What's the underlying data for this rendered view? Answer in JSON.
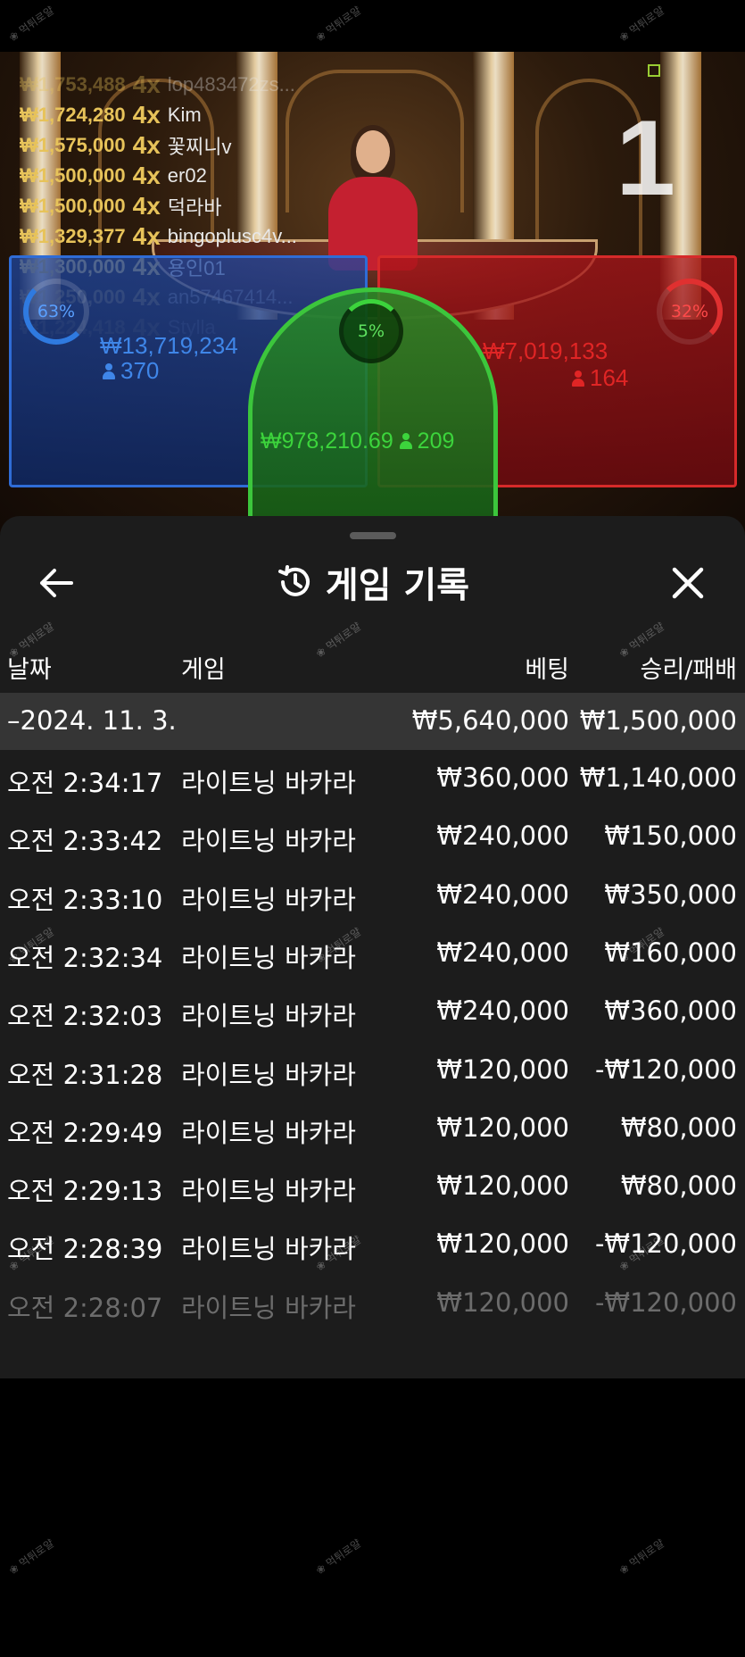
{
  "video": {
    "round_number": "1",
    "leaderboard": [
      {
        "amount": "₩1,753,488",
        "mult": "4x",
        "name": "lop483472zs..."
      },
      {
        "amount": "₩1,724,280",
        "mult": "4x",
        "name": "Kim"
      },
      {
        "amount": "₩1,575,000",
        "mult": "4x",
        "name": "꽃찌니v"
      },
      {
        "amount": "₩1,500,000",
        "mult": "4x",
        "name": "er02"
      },
      {
        "amount": "₩1,500,000",
        "mult": "4x",
        "name": "덕라바"
      },
      {
        "amount": "₩1,329,377",
        "mult": "4x",
        "name": "bingoplusc4v..."
      },
      {
        "amount": "₩1,300,000",
        "mult": "4x",
        "name": "용인01"
      },
      {
        "amount": "₩1,250,000",
        "mult": "4x",
        "name": "an57467414..."
      },
      {
        "amount": "₩1,224,418",
        "mult": "4x",
        "name": "Stylla"
      }
    ],
    "player": {
      "percent": "63%",
      "amount": "₩13,719,234",
      "count": "370",
      "color": "#2f7ae0"
    },
    "banker": {
      "percent": "32%",
      "amount": "₩7,019,133",
      "count": "164",
      "color": "#e03030"
    },
    "tie": {
      "percent": "5%",
      "amount": "₩978,210.69",
      "count": "209",
      "color": "#3cc63c"
    }
  },
  "history": {
    "title": "게임 기록",
    "columns": {
      "date": "날짜",
      "game": "게임",
      "bet": "베팅",
      "result": "승리/패배"
    },
    "group": {
      "date": "–2024. 11. 3.",
      "bet": "₩5,640,000",
      "result": "₩1,500,000"
    },
    "rows": [
      {
        "time": "오전 2:34:17",
        "game": "라이트닝 바카라",
        "bet": "₩360,000",
        "result": "₩1,140,000"
      },
      {
        "time": "오전 2:33:42",
        "game": "라이트닝 바카라",
        "bet": "₩240,000",
        "result": "₩150,000"
      },
      {
        "time": "오전 2:33:10",
        "game": "라이트닝 바카라",
        "bet": "₩240,000",
        "result": "₩350,000"
      },
      {
        "time": "오전 2:32:34",
        "game": "라이트닝 바카라",
        "bet": "₩240,000",
        "result": "₩160,000"
      },
      {
        "time": "오전 2:32:03",
        "game": "라이트닝 바카라",
        "bet": "₩240,000",
        "result": "₩360,000"
      },
      {
        "time": "오전 2:31:28",
        "game": "라이트닝 바카라",
        "bet": "₩120,000",
        "result": "-₩120,000"
      },
      {
        "time": "오전 2:29:49",
        "game": "라이트닝 바카라",
        "bet": "₩120,000",
        "result": "₩80,000"
      },
      {
        "time": "오전 2:29:13",
        "game": "라이트닝 바카라",
        "bet": "₩120,000",
        "result": "₩80,000"
      },
      {
        "time": "오전 2:28:39",
        "game": "라이트닝 바카라",
        "bet": "₩120,000",
        "result": "-₩120,000"
      },
      {
        "time": "오전 2:28:07",
        "game": "라이트닝 바카라",
        "bet": "₩120,000",
        "result": "-₩120,000"
      }
    ]
  }
}
